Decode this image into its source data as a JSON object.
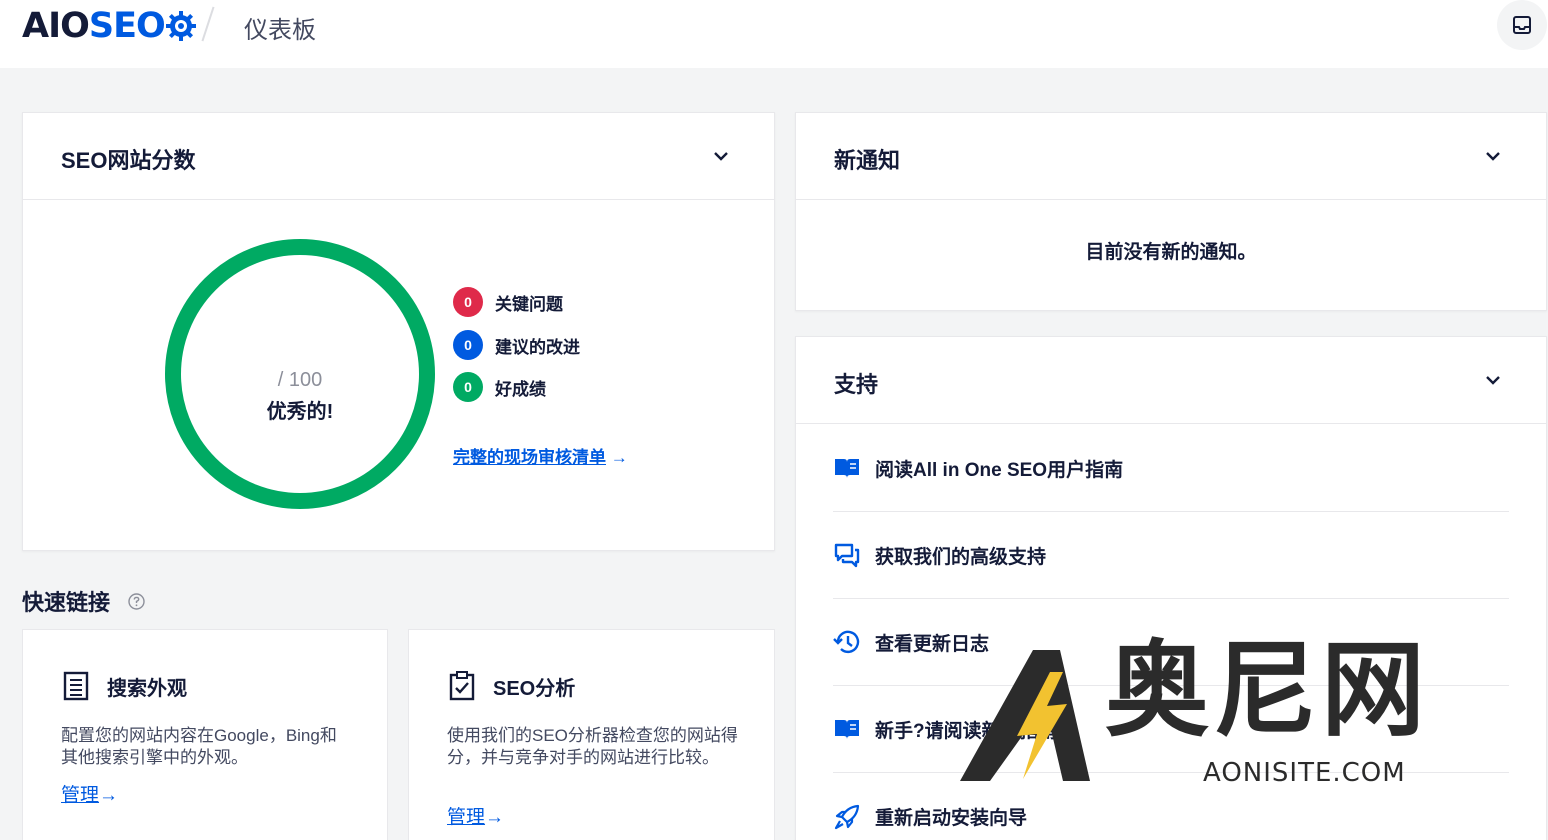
{
  "header": {
    "logo_a": "AIO",
    "logo_b": "SEO",
    "page_title": "仪表板"
  },
  "seo_score": {
    "title": "SEO网站分数",
    "max_label": "/ 100",
    "grade_label": "优秀的!",
    "issues": [
      {
        "count": "0",
        "label": "关键问题",
        "color": "#df2a4a"
      },
      {
        "count": "0",
        "label": "建议的改进",
        "color": "#005ae0"
      },
      {
        "count": "0",
        "label": "好成绩",
        "color": "#00aa63"
      }
    ],
    "audit_link": "完整的现场审核清单",
    "audit_arrow": "→"
  },
  "notifications": {
    "title": "新通知",
    "empty_text": "目前没有新的通知。"
  },
  "support": {
    "title": "支持",
    "items": [
      {
        "label": "阅读All in One SEO用户指南",
        "icon": "book-icon"
      },
      {
        "label": "获取我们的高级支持",
        "icon": "chat-icon"
      },
      {
        "label": "查看更新日志",
        "icon": "history-icon"
      },
      {
        "label": "新手?请阅读新手指南",
        "icon": "book-icon"
      },
      {
        "label": "重新启动安装向导",
        "icon": "rocket-icon"
      }
    ]
  },
  "quick_links": {
    "title": "快速链接",
    "cards": [
      {
        "title": "搜索外观",
        "desc": "配置您的网站内容在Google，Bing和其他搜索引擎中的外观。",
        "link": "管理",
        "arrow": "→"
      },
      {
        "title": "SEO分析",
        "desc": "使用我们的SEO分析器检查您的网站得分，并与竞争对手的网站进行比较。",
        "link": "管理",
        "arrow": "→"
      }
    ]
  },
  "watermark": {
    "main": "奥尼网",
    "sub": "AONISITE.COM"
  }
}
